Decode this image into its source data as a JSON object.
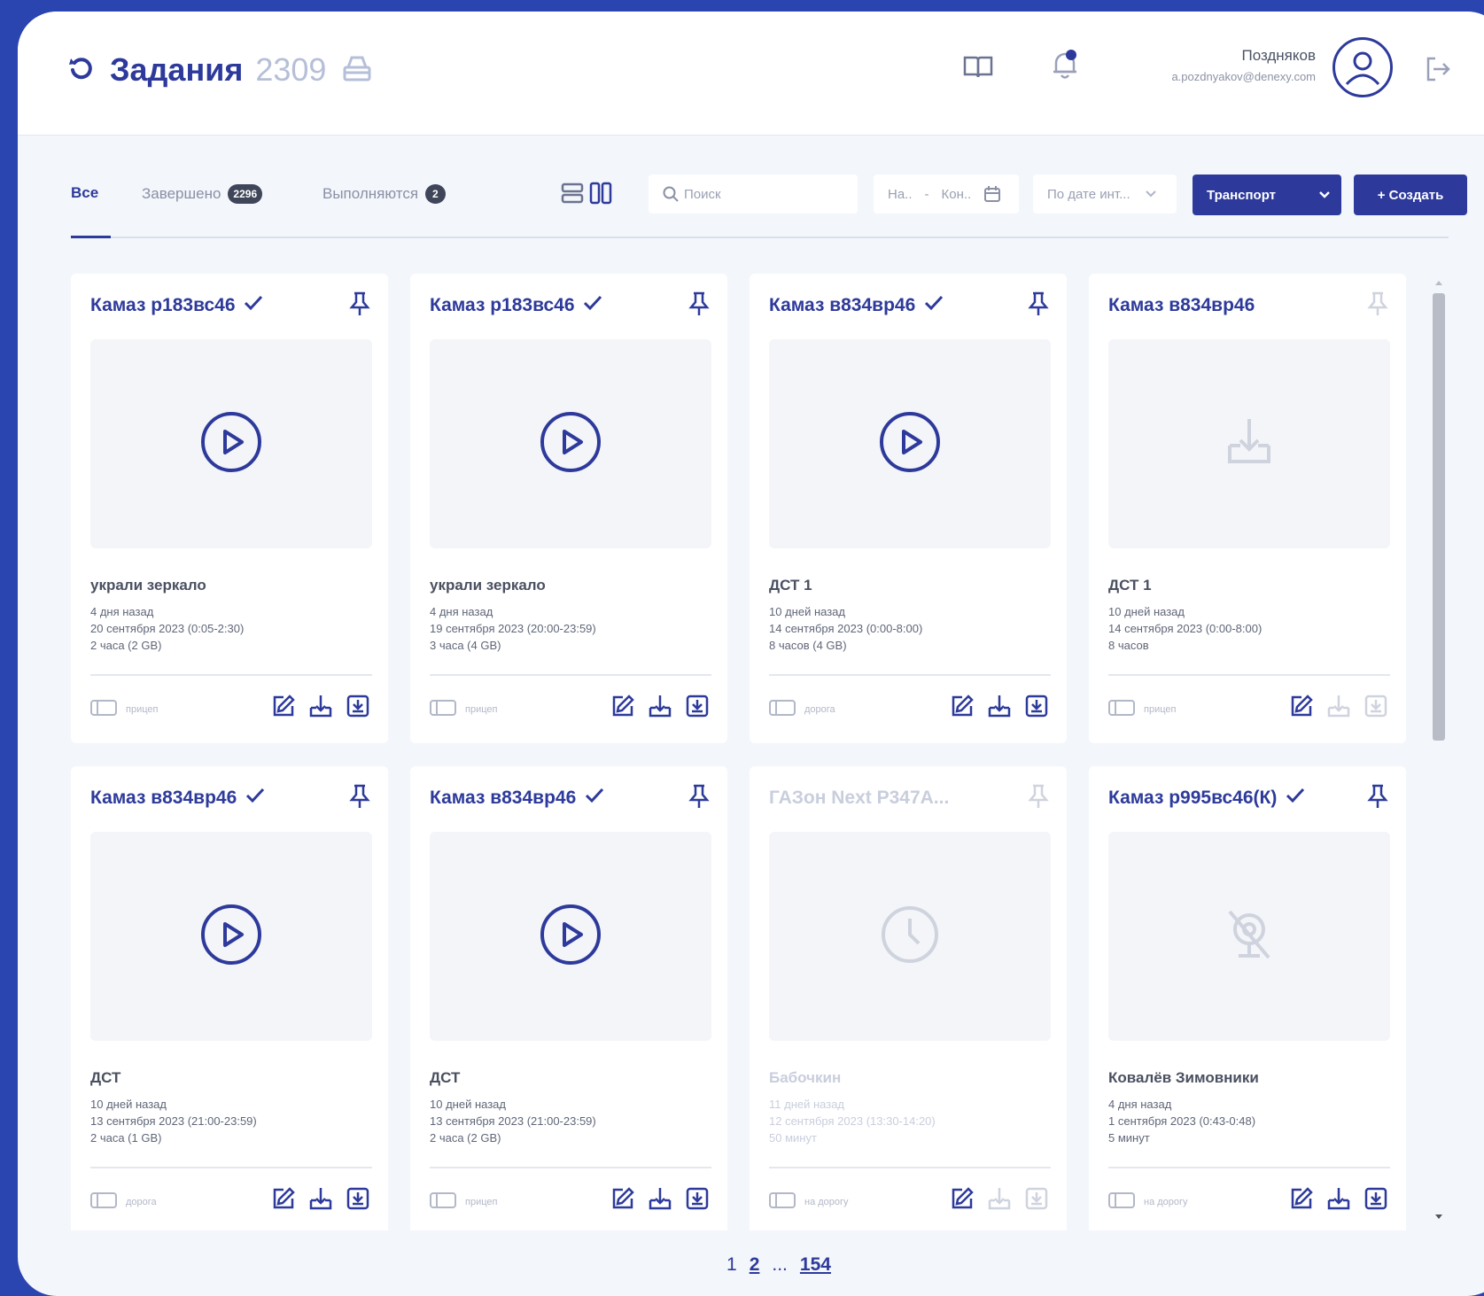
{
  "header": {
    "title": "Задания",
    "count": "2309",
    "user_name": "Поздняков",
    "user_email": "a.pozdnyakov@denexy.com"
  },
  "toolbar": {
    "tabs": [
      {
        "label": "Все",
        "badge": ""
      },
      {
        "label": "Завершено",
        "badge": "2296"
      },
      {
        "label": "Выполняются",
        "badge": "2"
      }
    ],
    "search_placeholder": "Поиск",
    "date_start": "На..",
    "date_sep": "-",
    "date_end": "Кон..",
    "sort_label": "По дате инт...",
    "transport_label": "Транспорт",
    "create_label": "+ Создать"
  },
  "cards": [
    {
      "title": "Камаз р183вс46",
      "check": "✓",
      "thumb": "play",
      "caption": "украли зеркало",
      "ago": "4 дня назад",
      "date": "20 сентября 2023 (0:05-2:30)",
      "size": "2 часа (2 GB)",
      "tag": "прицеп",
      "dim": false,
      "download_enabled": true
    },
    {
      "title": "Камаз р183вс46",
      "check": "✓",
      "thumb": "play",
      "caption": "украли зеркало",
      "ago": "4 дня назад",
      "date": "19 сентября 2023 (20:00-23:59)",
      "size": "3 часа (4 GB)",
      "tag": "прицеп",
      "dim": false,
      "download_enabled": true
    },
    {
      "title": "Камаз в834вр46",
      "check": "✓",
      "thumb": "play",
      "caption": "ДСТ 1",
      "ago": "10 дней назад",
      "date": "14 сентября 2023 (0:00-8:00)",
      "size": "8 часов (4 GB)",
      "tag": "дорога",
      "dim": false,
      "download_enabled": true
    },
    {
      "title": "Камаз в834вр46",
      "check": "",
      "thumb": "upload",
      "caption": "ДСТ 1",
      "ago": "10 дней назад",
      "date": "14 сентября 2023 (0:00-8:00)",
      "size": "8 часов",
      "tag": "прицеп",
      "dim": false,
      "download_enabled": false
    },
    {
      "title": "Камаз в834вр46",
      "check": "✓",
      "thumb": "play",
      "caption": "ДСТ",
      "ago": "10 дней назад",
      "date": "13 сентября 2023 (21:00-23:59)",
      "size": "2 часа (1 GB)",
      "tag": "дорога",
      "dim": false,
      "download_enabled": true
    },
    {
      "title": "Камаз в834вр46",
      "check": "✓",
      "thumb": "play",
      "caption": "ДСТ",
      "ago": "10 дней назад",
      "date": "13 сентября 2023 (21:00-23:59)",
      "size": "2 часа (2 GB)",
      "tag": "прицеп",
      "dim": false,
      "download_enabled": true
    },
    {
      "title": "ГАЗон Next Р347А...",
      "check": "",
      "thumb": "clock",
      "caption": "Бабочкин",
      "ago": "11 дней назад",
      "date": "12 сентября 2023 (13:30-14:20)",
      "size": "50 минут",
      "tag": "на дорогу",
      "dim": true,
      "download_enabled": false
    },
    {
      "title": "Камаз р995вс46(К)",
      "check": "✓",
      "thumb": "nocam",
      "caption": "Ковалёв Зимовники",
      "ago": "4 дня назад",
      "date": "1 сентября 2023 (0:43-0:48)",
      "size": "5 минут",
      "tag": "на дорогу",
      "dim": false,
      "download_enabled": true
    }
  ],
  "pager": {
    "p1": "1",
    "p2": "2",
    "ellipsis": "...",
    "last": "154"
  }
}
